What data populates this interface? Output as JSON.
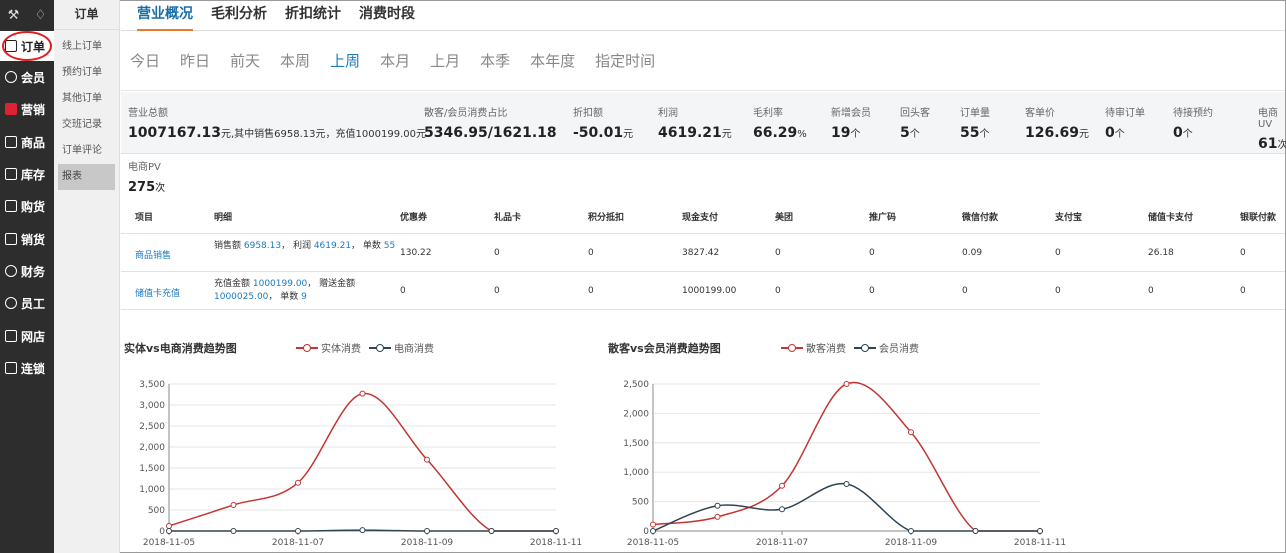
{
  "nav": {
    "top_icons": [
      "wrench-icon",
      "bell-icon"
    ],
    "items": [
      {
        "label": "订单",
        "icon": "order-icon"
      },
      {
        "label": "会员",
        "icon": "member-icon"
      },
      {
        "label": "营销",
        "icon": "marketing-icon"
      },
      {
        "label": "商品",
        "icon": "goods-icon"
      },
      {
        "label": "库存",
        "icon": "stock-icon"
      },
      {
        "label": "购货",
        "icon": "purchase-icon"
      },
      {
        "label": "销货",
        "icon": "sales-icon"
      },
      {
        "label": "财务",
        "icon": "finance-icon"
      },
      {
        "label": "员工",
        "icon": "staff-icon"
      },
      {
        "label": "网店",
        "icon": "shop-icon"
      },
      {
        "label": "连锁",
        "icon": "chain-icon"
      }
    ]
  },
  "subnav": {
    "title": "订单",
    "items": [
      "线上订单",
      "预约订单",
      "其他订单",
      "交班记录",
      "订单评论",
      "报表"
    ]
  },
  "tabs": [
    "营业概况",
    "毛利分析",
    "折扣统计",
    "消费时段"
  ],
  "periods": [
    "今日",
    "昨日",
    "前天",
    "本周",
    "上周",
    "本月",
    "上月",
    "本季",
    "本年度",
    "指定时间"
  ],
  "metrics": [
    {
      "label": "营业总额",
      "value": "1007167.13",
      "unit": "元,其中销售6958.13元，充值1000199.00元"
    },
    {
      "label": "散客/会员消费占比",
      "value": "5346.95/1621.18",
      "unit": ""
    },
    {
      "label": "折扣额",
      "value": "-50.01",
      "unit": "元"
    },
    {
      "label": "利润",
      "value": "4619.21",
      "unit": "元"
    },
    {
      "label": "毛利率",
      "value": "66.29",
      "unit": "%"
    },
    {
      "label": "新增会员",
      "value": "19",
      "unit": "个"
    },
    {
      "label": "回头客",
      "value": "5",
      "unit": "个"
    },
    {
      "label": "订单量",
      "value": "55",
      "unit": "个"
    },
    {
      "label": "客单价",
      "value": "126.69",
      "unit": "元"
    },
    {
      "label": "待审订单",
      "value": "0",
      "unit": "个"
    },
    {
      "label": "待接预约",
      "value": "0",
      "unit": "个"
    },
    {
      "label": "电商UV",
      "value": "61",
      "unit": "次"
    }
  ],
  "pv": {
    "label": "电商PV",
    "value": "275",
    "unit": "次"
  },
  "table": {
    "headers": [
      "项目",
      "明细",
      "优惠券",
      "礼品卡",
      "积分抵扣",
      "现金支付",
      "美团",
      "推广码",
      "微信付款",
      "支付宝",
      "储值卡支付",
      "银联付款"
    ],
    "rows": [
      {
        "name": "商品销售",
        "detail": {
          "a": "销售额 ",
          "av": "6958.13",
          "b": "， 利润 ",
          "bv": "4619.21",
          "c": "， 单数 ",
          "cv": "55"
        },
        "cells": [
          "130.22",
          "0",
          "0",
          "3827.42",
          "0",
          "0",
          "0.09",
          "0",
          "26.18",
          "0"
        ]
      },
      {
        "name": "储值卡充值",
        "detail": {
          "a": "充值金额 ",
          "av": "1000199.00",
          "b": "， 赠送金额 ",
          "bv": "1000025.00",
          "c": "， 单数 ",
          "cv": "9"
        },
        "cells": [
          "0",
          "0",
          "0",
          "1000199.00",
          "0",
          "0",
          "0",
          "0",
          "0",
          "0"
        ]
      }
    ]
  },
  "chart_data": [
    {
      "type": "line",
      "title": "实体vs电商消费趋势图",
      "x": [
        "2018-11-05",
        "2018-11-06",
        "2018-11-07",
        "2018-11-08",
        "2018-11-09",
        "2018-11-10",
        "2018-11-11"
      ],
      "xticks": [
        "2018-11-05",
        "2018-11-07",
        "2018-11-09",
        "2018-11-11"
      ],
      "ylim": [
        0,
        3500
      ],
      "yticks": [
        0,
        500,
        1000,
        1500,
        2000,
        2500,
        3000,
        3500
      ],
      "series": [
        {
          "name": "实体消费",
          "color": "#c23531",
          "values": [
            120,
            620,
            1150,
            3270,
            1700,
            0,
            0
          ]
        },
        {
          "name": "电商消费",
          "color": "#2f4554",
          "values": [
            0,
            0,
            0,
            20,
            0,
            0,
            0
          ]
        }
      ]
    },
    {
      "type": "line",
      "title": "散客vs会员消费趋势图",
      "x": [
        "2018-11-05",
        "2018-11-06",
        "2018-11-07",
        "2018-11-08",
        "2018-11-09",
        "2018-11-10",
        "2018-11-11"
      ],
      "xticks": [
        "2018-11-05",
        "2018-11-07",
        "2018-11-09",
        "2018-11-11"
      ],
      "ylim": [
        0,
        2500
      ],
      "yticks": [
        0,
        500,
        1000,
        1500,
        2000,
        2500
      ],
      "series": [
        {
          "name": "散客消费",
          "color": "#c23531",
          "values": [
            110,
            240,
            770,
            2500,
            1680,
            0,
            0
          ]
        },
        {
          "name": "会员消费",
          "color": "#2f4554",
          "values": [
            0,
            430,
            370,
            800,
            0,
            0,
            0
          ]
        }
      ]
    }
  ]
}
